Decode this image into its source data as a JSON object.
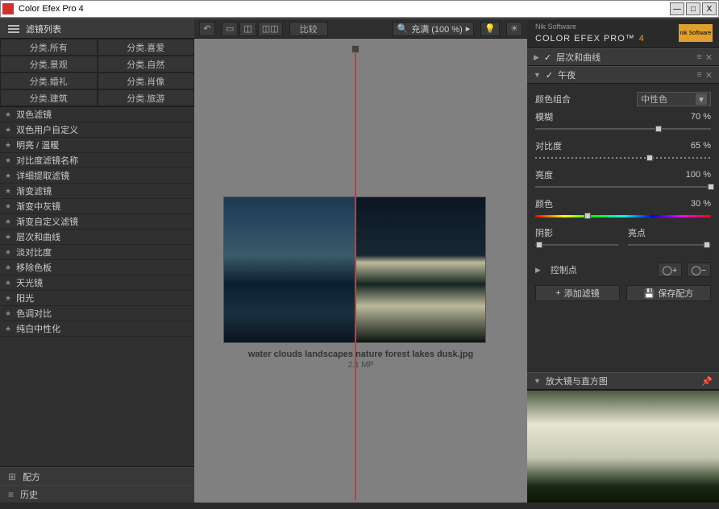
{
  "window": {
    "title": "Color Efex Pro 4"
  },
  "left": {
    "header": "滤镜列表",
    "categories": [
      "分类.所有",
      "分类.喜爱",
      "分类.景观",
      "分类.自然",
      "分类.婚礼",
      "分类.肖像",
      "分类.建筑",
      "分类.旅游"
    ],
    "filters": [
      "双色滤镜",
      "双色用户自定义",
      "明亮 / 温暖",
      "对比度滤镜名称",
      "详细提取滤镜",
      "渐变滤镜",
      "渐变中灰镜",
      "渐变自定义滤镜",
      "层次和曲线",
      "淡对比度",
      "移除色板",
      "天光镜",
      "阳光",
      "色调对比",
      "纯白中性化"
    ],
    "tab_recipe": "配方",
    "tab_history": "历史"
  },
  "toolbar": {
    "compare": "比较",
    "zoom_label": "充满 (100 %)"
  },
  "image": {
    "filename": "water clouds landscapes nature forest lakes dusk.jpg",
    "size": "2.1 MP"
  },
  "brand": {
    "software": "Nik Software",
    "name": "COLOR EFEX PRO™",
    "num": "4",
    "logo": "nik Software"
  },
  "panels": {
    "p1": "层次和曲线",
    "p2": "午夜"
  },
  "params": {
    "color_combo_label": "颜色组合",
    "color_combo_value": "中性色",
    "blur_label": "模糊",
    "blur_value": "70 %",
    "contrast_label": "对比度",
    "contrast_value": "65 %",
    "bright_label": "亮度",
    "bright_value": "100 %",
    "color_label": "颜色",
    "color_value": "30 %",
    "shadow_label": "阴影",
    "highlight_label": "亮点",
    "cpoint": "控制点",
    "add_filter": "添加滤镜",
    "save_recipe": "保存配方",
    "loupe": "放大镜与直方图"
  }
}
